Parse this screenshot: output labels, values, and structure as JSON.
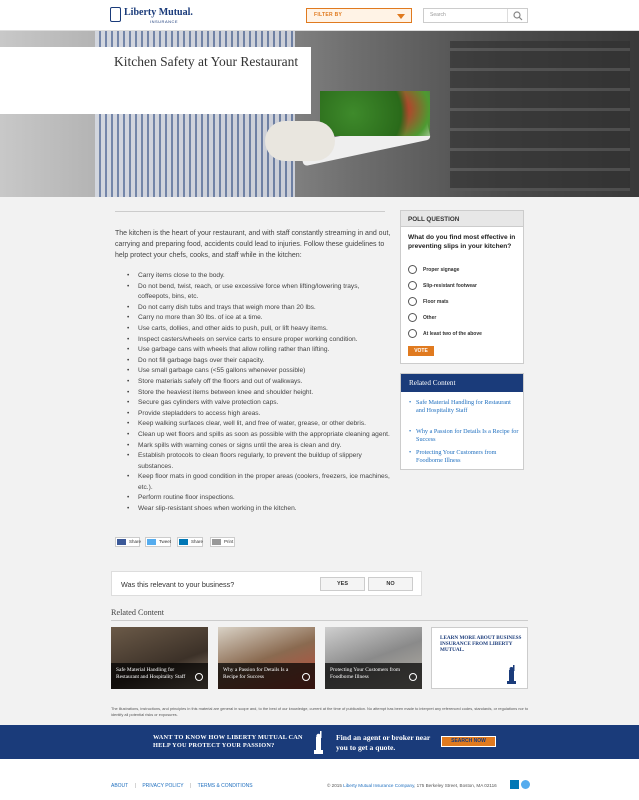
{
  "header": {
    "logo_name": "Liberty Mutual.",
    "logo_sub": "INSURANCE",
    "filter_label": "FILTER BY",
    "search_placeholder": "Search"
  },
  "hero": {
    "title": "Kitchen Safety at Your Restaurant"
  },
  "article": {
    "intro": "The kitchen is the heart of your restaurant, and with staff constantly streaming in and out, carrying and preparing food, accidents could lead to injuries. Follow these guidelines to help protect your chefs, cooks, and staff while in the kitchen:",
    "bullets": [
      "Carry items close to the body.",
      "Do not bend, twist, reach, or use excessive force when lifting/lowering trays, coffeepots, bins, etc.",
      "Do not carry dish tubs and trays that weigh more than 20 lbs.",
      "Carry no more than 30 lbs. of ice at a time.",
      "Use carts, dollies, and other aids to push, pull, or lift heavy items.",
      "Inspect casters/wheels on service carts to ensure proper working condition.",
      "Use garbage cans with wheels that allow rolling rather than lifting.",
      "Do not fill garbage bags over their capacity.",
      "Use small garbage cans (<55 gallons whenever possible)",
      "Store materials safely off the floors and out of walkways.",
      "Store the heaviest items between knee and shoulder height.",
      "Secure gas cylinders with valve protection caps.",
      "Provide stepladders to access high areas.",
      "Keep walking surfaces clear, well lit, and free of water, grease, or other debris.",
      "Clean up wet floors and spills as soon as possible with the appropriate cleaning agent.",
      "Mark spills with warning cones or signs until the area is clean and dry.",
      "Establish protocols to clean floors regularly, to prevent the buildup of slippery substances.",
      "Keep floor mats in good condition in the proper areas (coolers, freezers, ice machines, etc.).",
      "Perform routine floor inspections.",
      "Wear slip-resistant shoes when working in the kitchen."
    ]
  },
  "share": {
    "facebook": "Share",
    "twitter": "Tweet",
    "linkedin": "Share",
    "print": "Print"
  },
  "feedback": {
    "question": "Was this relevant to your business?",
    "yes": "YES",
    "no": "NO"
  },
  "related_bottom": {
    "title": "Related Content",
    "cards": [
      "Safe Material Handling for Restaurant and Hospitality Staff",
      "Why a Passion for Details Is a Recipe for Success",
      "Protecting Your Customers from Foodborne Illness"
    ],
    "learn_more": "LEARN MORE ABOUT BUSINESS INSURANCE FROM LIBERTY MUTUAL."
  },
  "poll": {
    "header": "POLL QUESTION",
    "question": "What do you find most effective in preventing slips in your kitchen?",
    "options": [
      "Proper signage",
      "Slip-resistant footwear",
      "Floor mats",
      "Other",
      "At least two of the above"
    ],
    "vote": "VOTE"
  },
  "related_side": {
    "title": "Related Content",
    "links": [
      "Safe Material Handling for Restaurant and Hospitality Staff",
      "Why a Passion for Details Is a Recipe for Success",
      "Protecting Your Customers from Foodborne Illness"
    ]
  },
  "disclaimer": "The illustrations, instructions, and principles in this material are general in scope and, to the best of our knowledge, current at the time of publication. No attempt has been made to interpret any referenced codes, standards, or regulations nor to identify all potential risks or exposures.",
  "banner": {
    "left": "WANT TO KNOW HOW LIBERTY MUTUAL CAN HELP YOU PROTECT YOUR PASSION?",
    "right": "Find an agent or broker near you to get a quote.",
    "button": "SEARCH NOW"
  },
  "footer": {
    "about": "ABOUT",
    "privacy": "PRIVACY POLICY",
    "terms": "TERMS & CONDITIONS",
    "copyright_pre": "© 2015 ",
    "company": "Liberty Mutual Insurance Company",
    "address": ", 175 Berkeley Street, Boston, MA 02116"
  },
  "colors": {
    "brand_blue": "#1a3b7a",
    "accent_orange": "#e07a1f",
    "link_blue": "#1f6fbf"
  }
}
